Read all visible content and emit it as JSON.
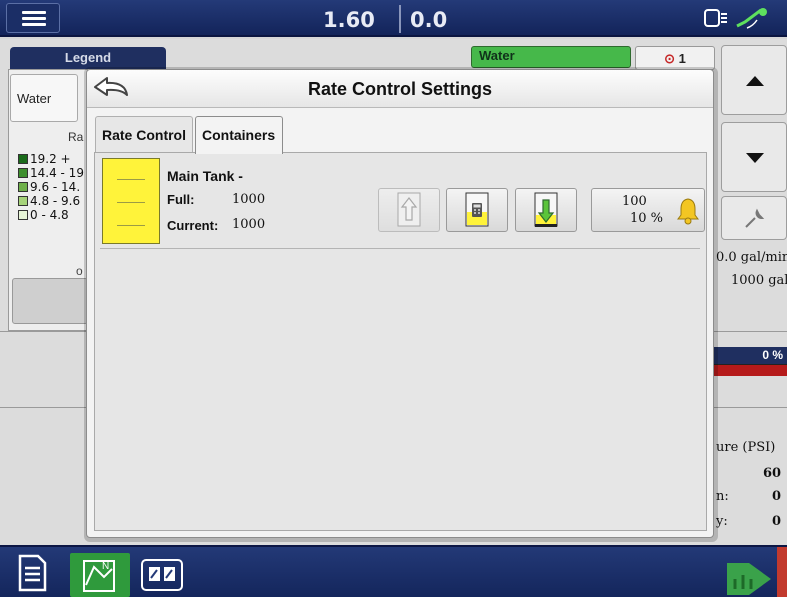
{
  "topbar": {
    "readout_left": "1.60",
    "readout_right": "0.0",
    "status_icons": "▢ ⦚ ≋"
  },
  "background": {
    "legend_tab": "Legend",
    "legend_product": "Water",
    "legend_rate_label": "Ra",
    "legend_ranges": [
      {
        "label": "19.2 +",
        "color": "#1a6a1a"
      },
      {
        "label": "14.4 - 19",
        "color": "#3e8f2e"
      },
      {
        "label": "9.6 - 14.",
        "color": "#6fb04a"
      },
      {
        "label": "4.8 - 9.6",
        "color": "#a6d37a"
      },
      {
        "label": "0 - 4.8",
        "color": "#e6f4d6"
      }
    ],
    "legend_o": "o",
    "product_chip": "Water",
    "target_chip_icon": "⊙",
    "target_chip_value": "1",
    "flow_readout": "0.0 gal/min",
    "volume_readout": "1000 gal",
    "percent_readout": "0 %",
    "pressure_label": "ure (PSI)",
    "pressure_value": "60",
    "row_n_label": "n:",
    "row_n_value": "0",
    "row_y_label": "y:",
    "row_y_value": "0"
  },
  "modal": {
    "title": "Rate Control Settings",
    "tabs": [
      {
        "label": "Rate Control",
        "active": false
      },
      {
        "label": "Containers",
        "active": true
      }
    ],
    "container": {
      "name": "Main Tank -",
      "full_label": "Full:",
      "full_value": "1000",
      "current_label": "Current:",
      "current_value": "1000",
      "swatch_color": "#fff33a",
      "alarm_amount": "100",
      "alarm_percent": "10 %"
    }
  },
  "colors": {
    "accent_blue": "#1f2f60",
    "active_green": "#2f9a3c",
    "tank_yellow": "#fff33a",
    "alert_red": "#b51a1a"
  }
}
